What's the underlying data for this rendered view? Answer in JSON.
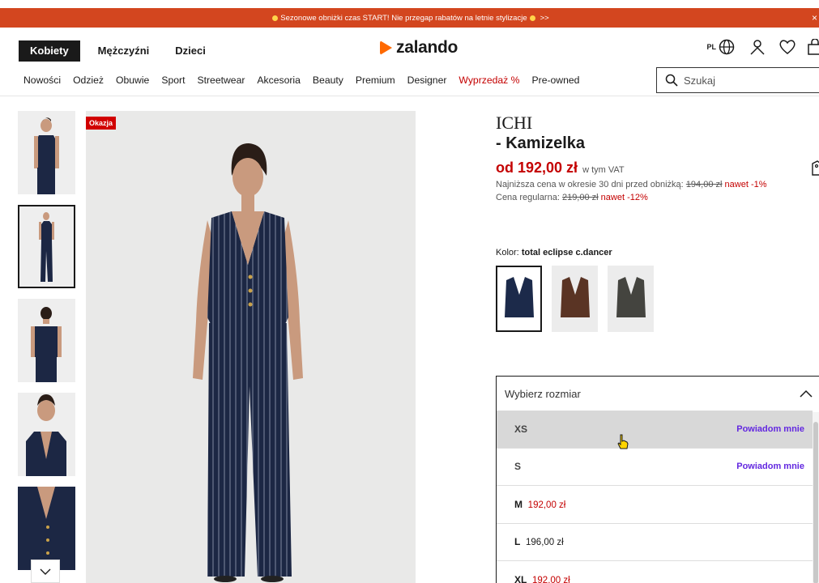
{
  "promo": {
    "text": "Sezonowe obniżki czas START! Nie przegap rabatów na letnie stylizacje",
    "arrow": ">>",
    "close": "×"
  },
  "header": {
    "gender_tabs": [
      "Kobiety",
      "Mężczyźni",
      "Dzieci"
    ],
    "logo_text": "zalando",
    "lang": "PL"
  },
  "nav": {
    "items": [
      "Nowości",
      "Odzież",
      "Obuwie",
      "Sport",
      "Streetwear",
      "Akcesoria",
      "Beauty",
      "Premium",
      "Designer",
      "Wyprzedaż %",
      "Pre-owned"
    ],
    "search_placeholder": "Szukaj"
  },
  "gallery": {
    "badge": "Okazja"
  },
  "product": {
    "brand": "ICHI",
    "name": "- Kamizelka",
    "price": "od 192,00 zł",
    "vat": "w tym VAT",
    "lowest_prefix": "Najniższa cena w okresie 30 dni przed obniżką:",
    "lowest_old": "194,00 zł",
    "lowest_discount": "nawet -1%",
    "regular_prefix": "Cena regularna:",
    "regular_old": "219,00 zł",
    "regular_discount": "nawet -12%",
    "color_label": "Kolor:",
    "color_name": "total eclipse c.dancer",
    "swatch_colors": [
      "#1c2a4a",
      "#5a3424",
      "#44443f"
    ]
  },
  "size": {
    "header": "Wybierz rozmiar",
    "options": [
      {
        "size": "XS",
        "action": "Powiadom mnie"
      },
      {
        "size": "S",
        "action": "Powiadom mnie"
      },
      {
        "size": "M",
        "price": "192,00 zł",
        "discounted": true
      },
      {
        "size": "L",
        "price": "196,00 zł",
        "discounted": false
      },
      {
        "size": "XL",
        "price": "192,00 zł",
        "discounted": true
      }
    ]
  },
  "colors": {
    "promo": "#d3461f",
    "sale_red": "#c40000",
    "notify_purple": "#6328e0",
    "logo_orange": "#ff6900"
  }
}
